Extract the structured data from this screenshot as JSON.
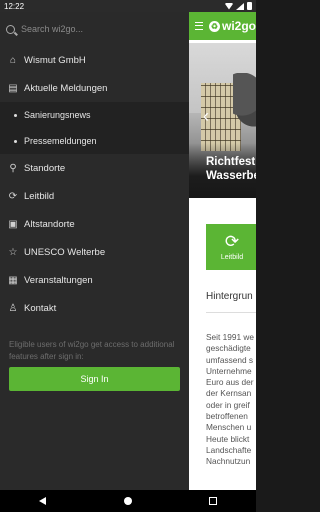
{
  "status": {
    "time": "12:22"
  },
  "app": {
    "logo_text": "wi2go",
    "hero_caption_line1": "Richtfest",
    "hero_caption_line2": "Wasserbe",
    "tile_label": "Leitbild",
    "section_title": "Hintergrun",
    "body_lines": [
      "Seit 1991 we",
      "geschädigte",
      "umfassend s",
      "Unternehme",
      "Euro aus der",
      "der Kernsan",
      "oder in greif",
      "betroffenen",
      "Menschen u",
      "Heute blickt",
      "Landschafte",
      "Nachnutzun"
    ]
  },
  "drawer": {
    "search_placeholder": "Search wi2go...",
    "items": [
      {
        "label": "Wismut GmbH",
        "icon": "house-icon"
      },
      {
        "label": "Aktuelle Meldungen",
        "icon": "newspaper-icon"
      }
    ],
    "sub_items": [
      {
        "label": "Sanierungsnews"
      },
      {
        "label": "Pressemeldungen"
      }
    ],
    "items2": [
      {
        "label": "Standorte",
        "icon": "map-pin-icon"
      },
      {
        "label": "Leitbild",
        "icon": "refresh-icon"
      },
      {
        "label": "Altstandorte",
        "icon": "image-icon"
      },
      {
        "label": "UNESCO Welterbe",
        "icon": "star-icon"
      },
      {
        "label": "Veranstaltungen",
        "icon": "calendar-icon"
      },
      {
        "label": "Kontakt",
        "icon": "person-icon"
      }
    ],
    "signin_note": "Eligible users of wi2go get access to additional features after sign in:",
    "signin_button": "Sign In"
  },
  "colors": {
    "accent": "#5bb534",
    "drawer_bg": "#2a2a2a"
  }
}
